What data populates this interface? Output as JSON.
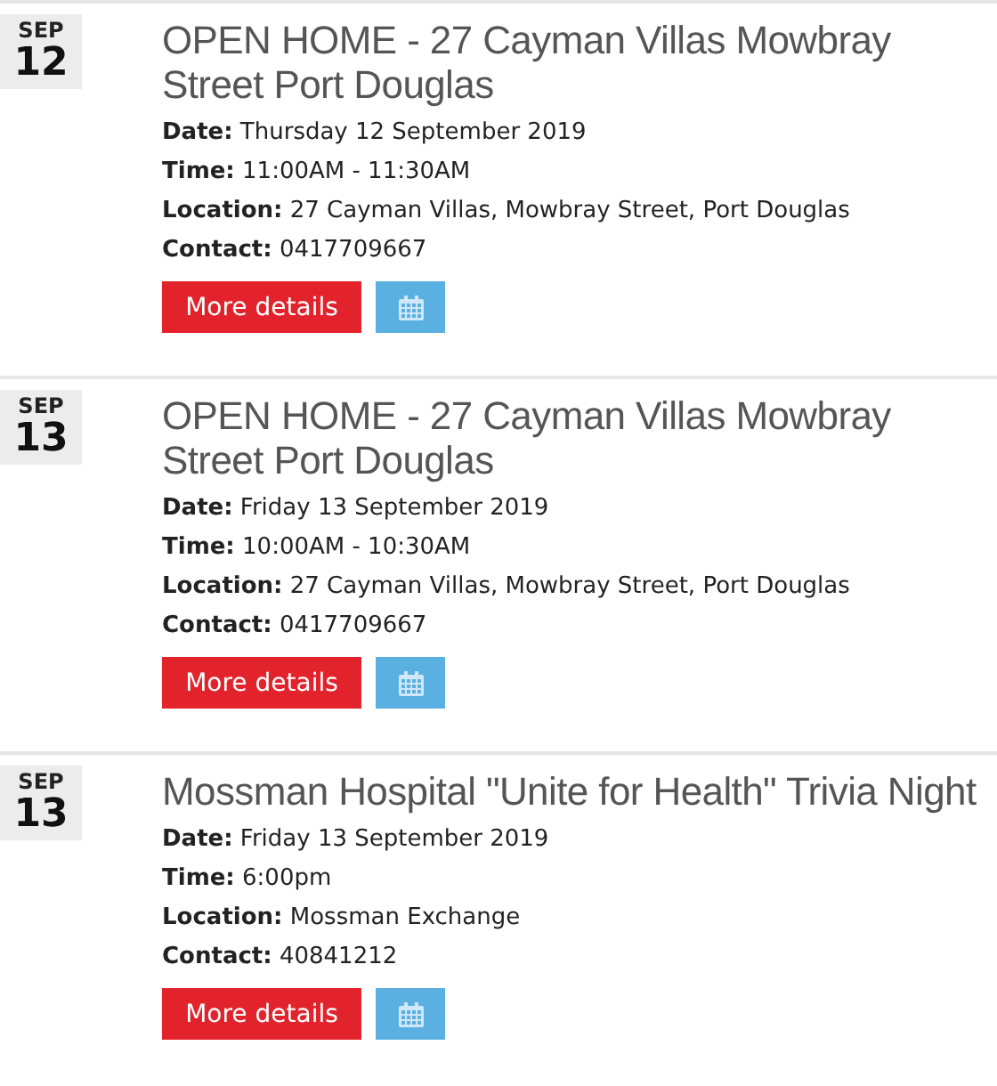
{
  "events": [
    {
      "month": "SEP",
      "day": "12",
      "title": "OPEN HOME - 27 Cayman Villas Mowbray Street Port Douglas",
      "details": [
        "**Date:** Thursday 12 September 2019",
        "**Time:** 11:00AM - 11:30AM",
        "**Location:** 27 Cayman Villas, Mowbray Street, Port Douglas",
        "**Contact:** 0417709667"
      ],
      "button": "More details"
    },
    {
      "month": "SEP",
      "day": "13",
      "title": "OPEN HOME - 27 Cayman Villas Mowbray Street Port Douglas",
      "details": [
        "**Date:** Friday 13 September 2019",
        "**Time:** 10:00AM - 10:30AM",
        "**Location:** 27 Cayman Villas, Mowbray Street, Port Douglas",
        "**Contact:** 0417709667"
      ],
      "button": "More details"
    },
    {
      "month": "SEP",
      "day": "13",
      "title": "Mossman Hospital \"Unite for Health\" Trivia Night",
      "details": [
        "**Date:** Friday 13 September 2019",
        "**Time:** 6:00pm",
        "**Location:** Mossman Exchange",
        "**Contact:** 40841212"
      ],
      "button": "More details"
    }
  ]
}
